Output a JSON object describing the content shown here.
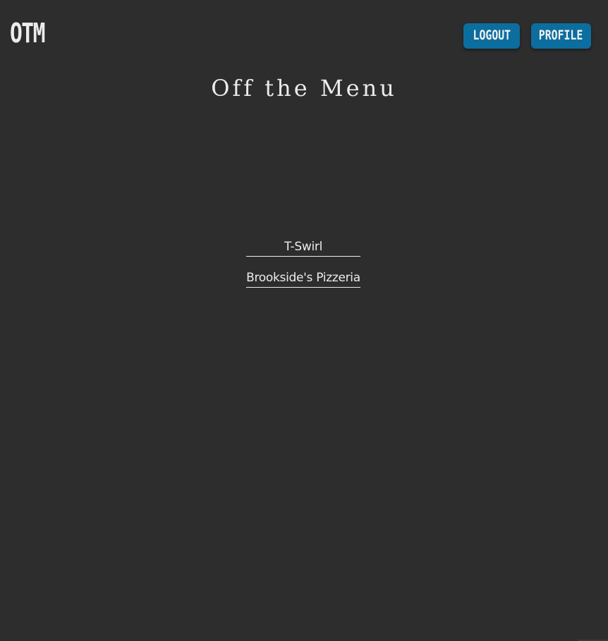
{
  "header": {
    "logo": "OTM",
    "logout_label": "Logout",
    "profile_label": "Profile"
  },
  "main": {
    "title": "Off the Menu",
    "restaurants": [
      {
        "name": "T-Swirl"
      },
      {
        "name": "Brookside's Pizzeria"
      }
    ]
  },
  "colors": {
    "background": "#2e2d2d",
    "text": "#ececec",
    "button": "#0c6e9e"
  }
}
